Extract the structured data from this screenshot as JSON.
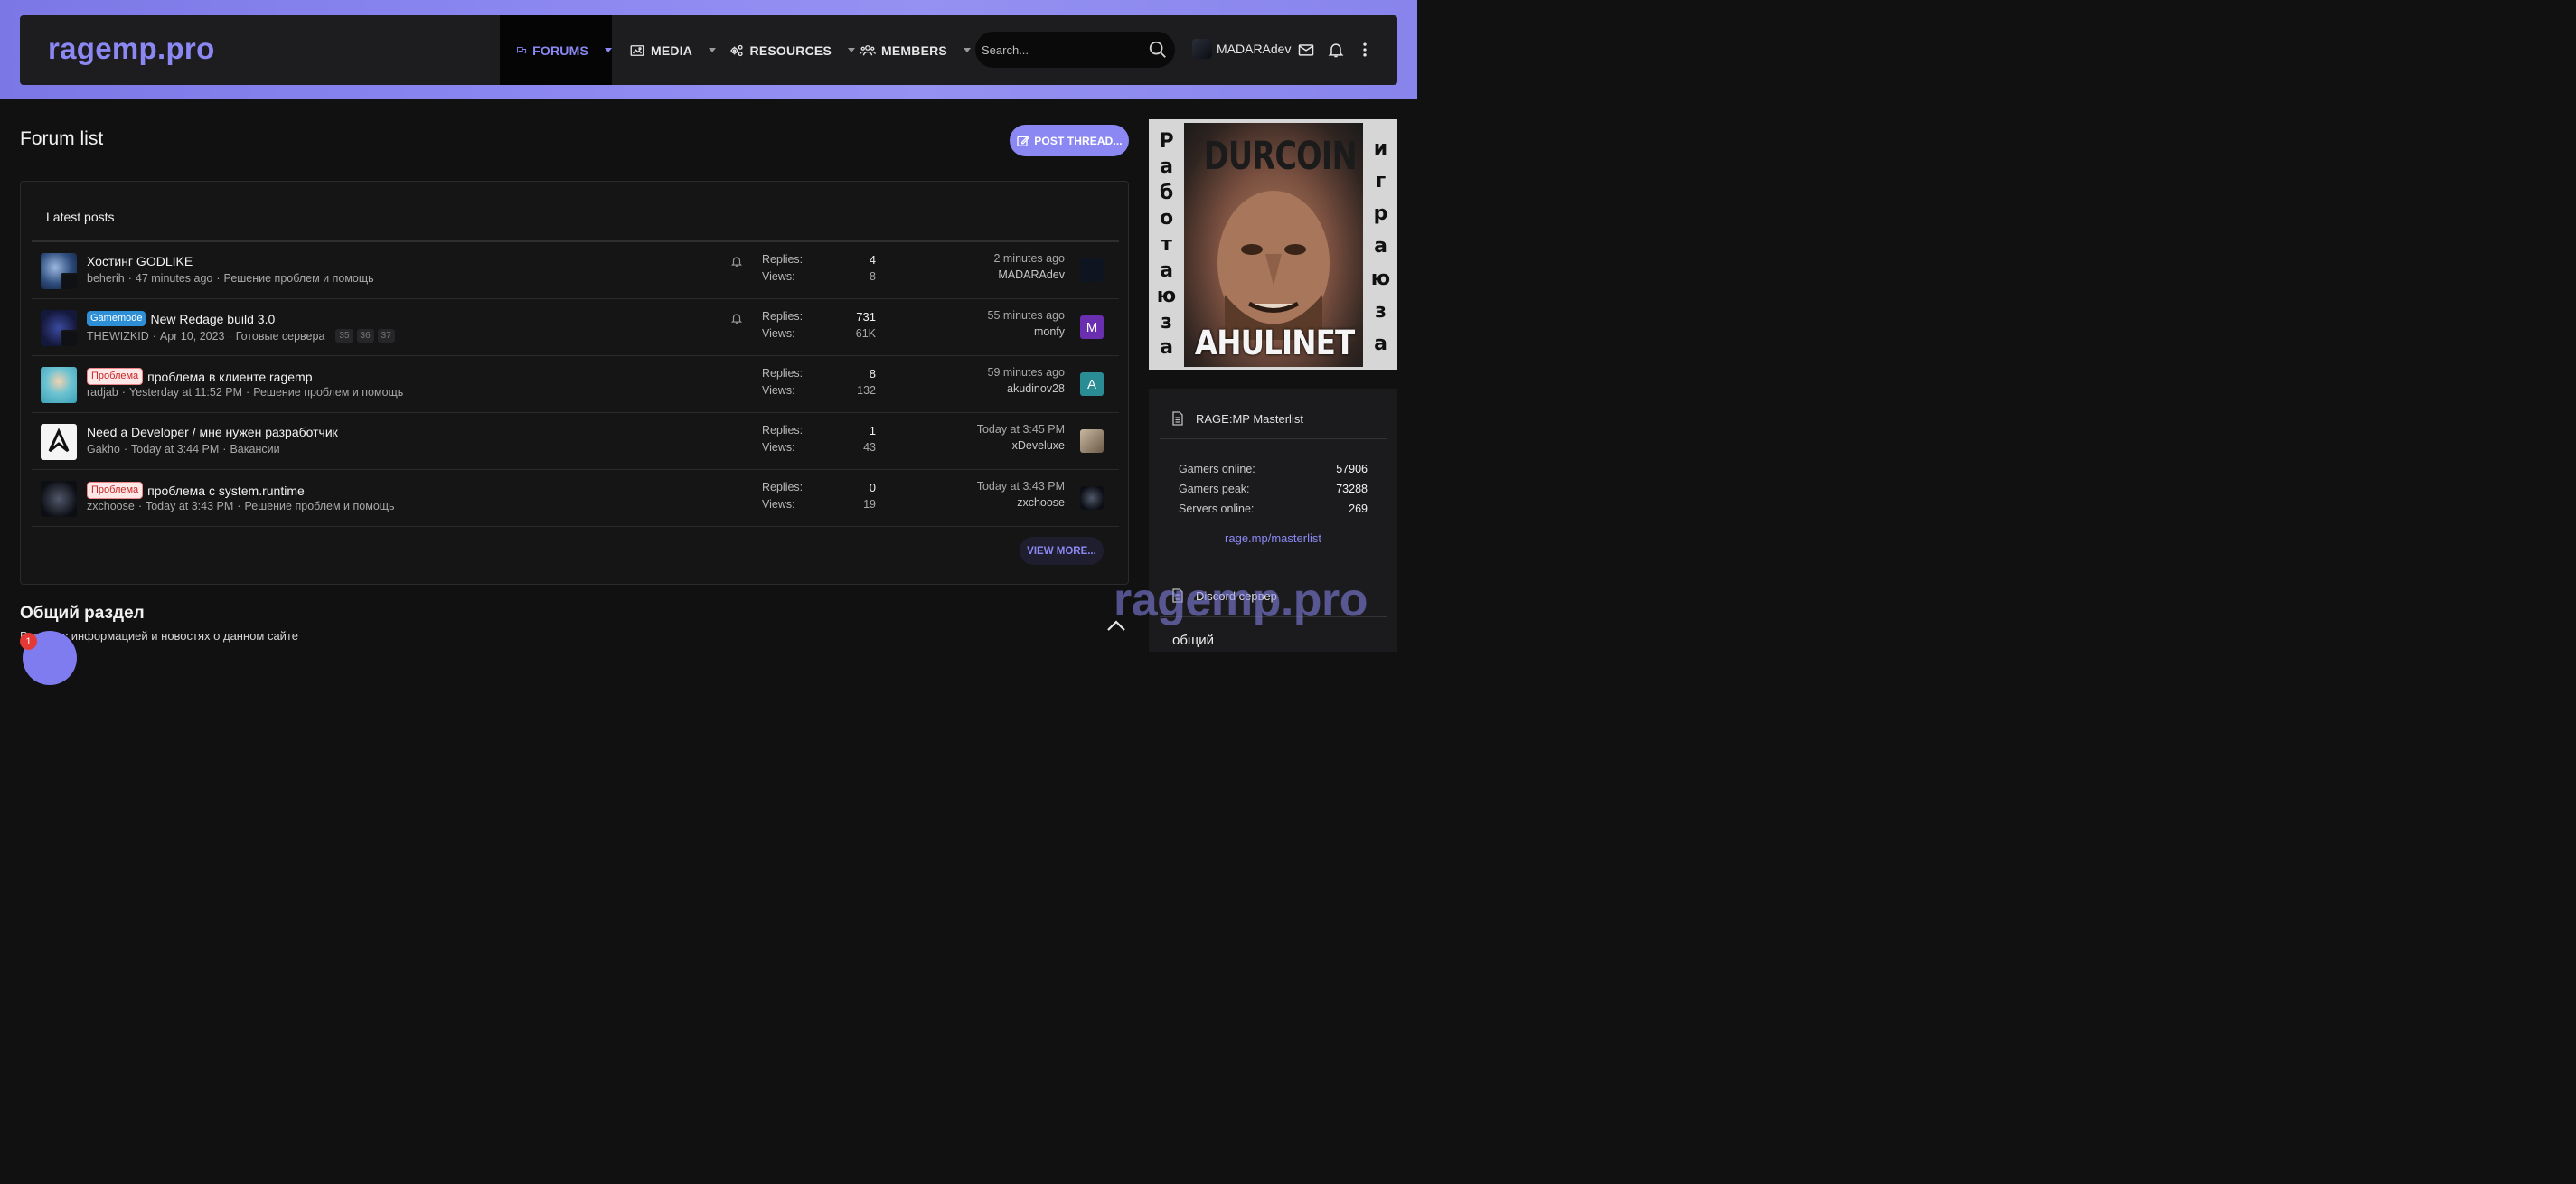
{
  "header": {
    "logo": "ragemp.pro",
    "nav": [
      {
        "label": "FORUMS",
        "icon": "chat-bubbles-icon",
        "active": true
      },
      {
        "label": "MEDIA",
        "icon": "image-icon",
        "active": false
      },
      {
        "label": "RESOURCES",
        "icon": "cogs-icon",
        "active": false
      },
      {
        "label": "MEMBERS",
        "icon": "users-icon",
        "active": false
      }
    ],
    "search_placeholder": "Search...",
    "username": "MADARAdev"
  },
  "main": {
    "title": "Forum list",
    "post_thread_label": "POST THREAD...",
    "latest_posts": {
      "heading": "Latest posts",
      "rows": [
        {
          "prefix": "",
          "title": "Хостинг GODLIKE",
          "author": "beherih",
          "date": "47 minutes ago",
          "forum": "Решение проблем и помощь",
          "pages": [],
          "watched": true,
          "replies_label": "Replies:",
          "replies": "4",
          "views_label": "Views:",
          "views": "8",
          "last_time": "2 minutes ago",
          "last_user": "MADARAdev",
          "last_avatar_letter": "",
          "last_avatar_color": "#0f1520"
        },
        {
          "prefix": "Gamemode",
          "prefix_type": "gm",
          "title": "New Redage build 3.0",
          "author": "THEWIZKID",
          "date": "Apr 10, 2023",
          "forum": "Готовые сервера",
          "pages": [
            "35",
            "36",
            "37"
          ],
          "watched": true,
          "replies_label": "Replies:",
          "replies": "731",
          "views_label": "Views:",
          "views": "61K",
          "last_time": "55 minutes ago",
          "last_user": "monfy",
          "last_avatar_letter": "M",
          "last_avatar_color": "#6a2fb0"
        },
        {
          "prefix": "Проблема",
          "prefix_type": "pr",
          "title": "проблема в клиенте ragemp",
          "author": "radjab",
          "date": "Yesterday at 11:52 PM",
          "forum": "Решение проблем и помощь",
          "pages": [],
          "watched": false,
          "replies_label": "Replies:",
          "replies": "8",
          "views_label": "Views:",
          "views": "132",
          "last_time": "59 minutes ago",
          "last_user": "akudinov28",
          "last_avatar_letter": "A",
          "last_avatar_color": "#2a8c95"
        },
        {
          "prefix": "",
          "title": "Need a Developer / мне нужен разработчик",
          "author": "Gakho",
          "date": "Today at 3:44 PM",
          "forum": "Вакансии",
          "pages": [],
          "watched": false,
          "replies_label": "Replies:",
          "replies": "1",
          "views_label": "Views:",
          "views": "43",
          "last_time": "Today at 3:45 PM",
          "last_user": "xDeveluxe",
          "last_avatar_letter": "",
          "last_avatar_color": "#8a7a68"
        },
        {
          "prefix": "Проблема",
          "prefix_type": "pr",
          "title": "проблема с system.runtime",
          "author": "zxchoose",
          "date": "Today at 3:43 PM",
          "forum": "Решение проблем и помощь",
          "pages": [],
          "watched": false,
          "replies_label": "Replies:",
          "replies": "0",
          "views_label": "Views:",
          "views": "19",
          "last_time": "Today at 3:43 PM",
          "last_user": "zxchoose",
          "last_avatar_letter": "",
          "last_avatar_color": "#1a1d24"
        }
      ],
      "view_more": "VIEW MORE..."
    },
    "section_title": "Общий раздел",
    "section_desc": "Раздел с информацией и новостях о данном сайте",
    "chat_badge": "1"
  },
  "sidebar": {
    "ad": {
      "left_letters": [
        "Р",
        "а",
        "б",
        "о",
        "т",
        "а",
        "ю",
        "з",
        "а"
      ],
      "right_letters": [
        "и",
        "г",
        "р",
        "а",
        "ю",
        "з",
        "а"
      ],
      "top_text": "DURCOIN",
      "bottom_text": "AHULINET"
    },
    "masterlist": {
      "title": "RAGE:MP Masterlist",
      "stats": [
        {
          "label": "Gamers online:",
          "value": "57906"
        },
        {
          "label": "Gamers peak:",
          "value": "73288"
        },
        {
          "label": "Servers online:",
          "value": "269"
        }
      ],
      "link": "rage.mp/masterlist"
    },
    "discord": {
      "title": "Discord сервер",
      "subtitle": "общий"
    }
  },
  "watermark": "ragemp.pro"
}
